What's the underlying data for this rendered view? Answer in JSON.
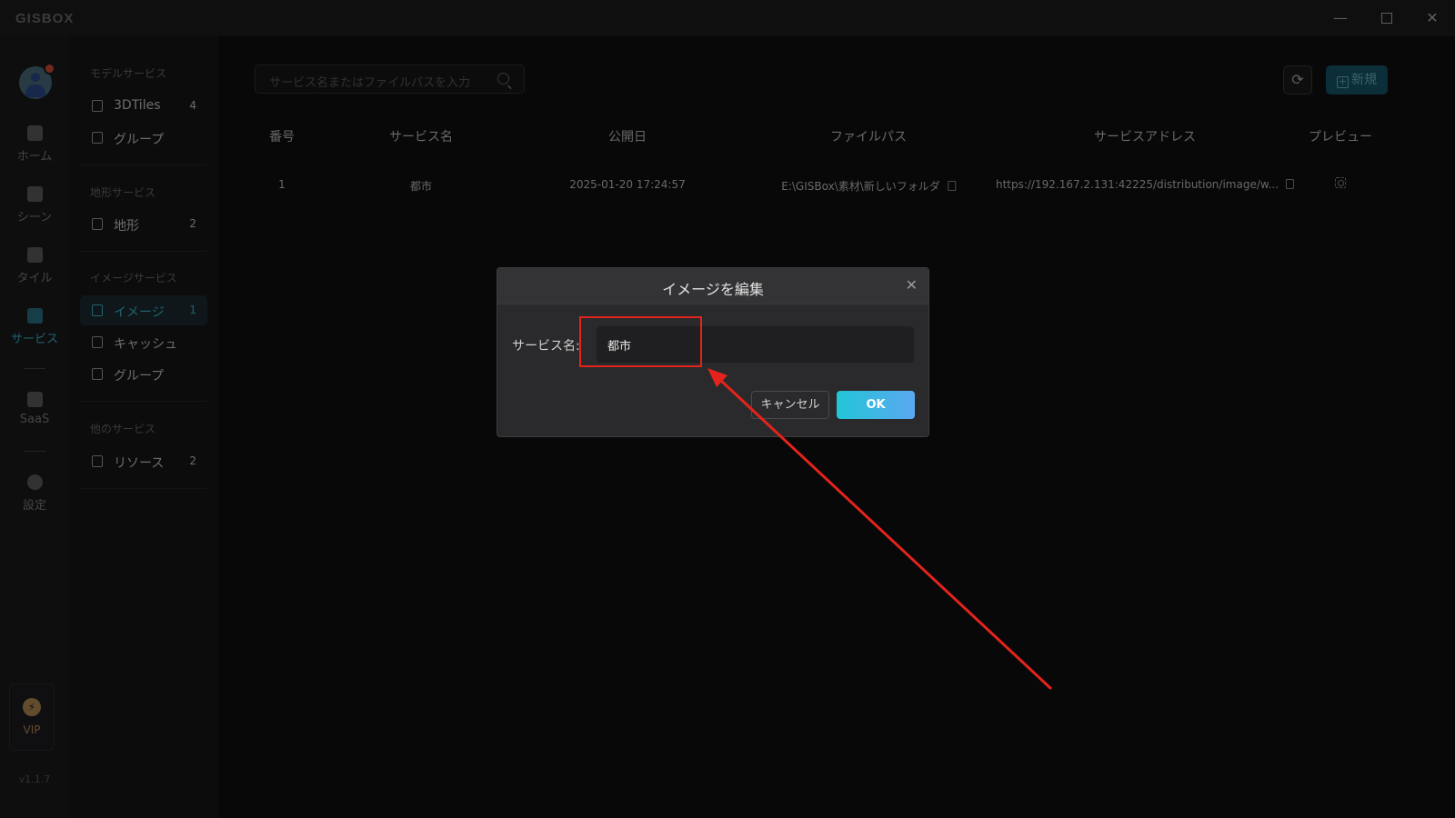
{
  "app": {
    "logo": "GISBOX",
    "version": "v1.1.7"
  },
  "window_controls": {
    "minimize": "—",
    "close": "✕"
  },
  "rail": {
    "items": [
      {
        "label": "ホーム",
        "icon": "home-icon",
        "active": false
      },
      {
        "label": "シーン",
        "icon": "scene-icon",
        "active": false
      },
      {
        "label": "タイル",
        "icon": "tile-icon",
        "active": false
      },
      {
        "label": "サービス",
        "icon": "service-icon",
        "active": true
      },
      {
        "label": "SaaS",
        "icon": "lock-icon",
        "active": false
      },
      {
        "label": "設定",
        "icon": "settings-icon",
        "active": false
      }
    ],
    "vip": "VIP",
    "vip_icon": "⚡"
  },
  "subnav": {
    "sections": [
      {
        "title": "モデルサービス",
        "items": [
          {
            "label": "3DTiles",
            "count": "4"
          },
          {
            "label": "グループ",
            "count": ""
          }
        ]
      },
      {
        "title": "地形サービス",
        "items": [
          {
            "label": "地形",
            "count": "2"
          }
        ]
      },
      {
        "title": "イメージサービス",
        "items": [
          {
            "label": "イメージ",
            "count": "1",
            "active": true
          },
          {
            "label": "キャッシュ",
            "count": ""
          },
          {
            "label": "グループ",
            "count": ""
          }
        ]
      },
      {
        "title": "他のサービス",
        "items": [
          {
            "label": "リソース",
            "count": "2"
          }
        ]
      }
    ]
  },
  "toolbar": {
    "search_placeholder": "サービス名またはファイルパスを入力",
    "refresh_icon": "⟳",
    "new_label": "新規",
    "new_icon": "+"
  },
  "table": {
    "headers": [
      "番号",
      "サービス名",
      "公開日",
      "ファイルパス",
      "サービスアドレス",
      "プレビュー"
    ],
    "rows": [
      {
        "no": "1",
        "name": "都市",
        "date": "2025-01-20 17:24:57",
        "path": "E:\\GISBox\\素材\\新しいフォルダ",
        "address": "https://192.167.2.131:42225/distribution/image/w..."
      }
    ]
  },
  "dialog": {
    "title": "イメージを編集",
    "close": "✕",
    "field_label": "サービス名:",
    "field_value": "都市",
    "cancel": "キャンセル",
    "ok": "OK"
  },
  "colors": {
    "accent": "#3ab3c7",
    "annotation": "#e4231c"
  }
}
